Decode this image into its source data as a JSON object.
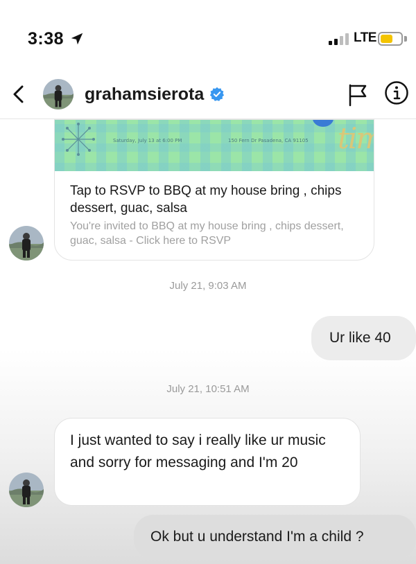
{
  "status_bar": {
    "time": "3:38",
    "network": "LTE",
    "signal_bars_on": 2,
    "signal_bars_total": 4,
    "battery_level": 0.6,
    "battery_color": "#f4c400"
  },
  "header": {
    "username": "grahamsierota",
    "verified": true,
    "verified_color": "#3897f0",
    "icons": [
      "back-icon",
      "verified-icon",
      "flag-icon",
      "info-icon"
    ]
  },
  "invite": {
    "banner_date": "Saturday, July 13 at 6:00 PM",
    "banner_address": "150 Fern Dr Pasadena, CA 91105",
    "banner_logo": "tim",
    "title": "Tap to RSVP to BBQ at my house bring , chips dessert, guac, salsa",
    "subtitle": "You're invited to BBQ at my house bring , chips dessert, guac, salsa - Click here to RSVP"
  },
  "messages": {
    "timestamp_1": "July 21, 9:03 AM",
    "sent_1": "Ur like 40",
    "timestamp_2": "July 21, 10:51 AM",
    "received_1": "I just wanted to say i really like ur music and sorry for messaging and I'm 20",
    "sent_2": "Ok but u understand I'm a child ?"
  }
}
